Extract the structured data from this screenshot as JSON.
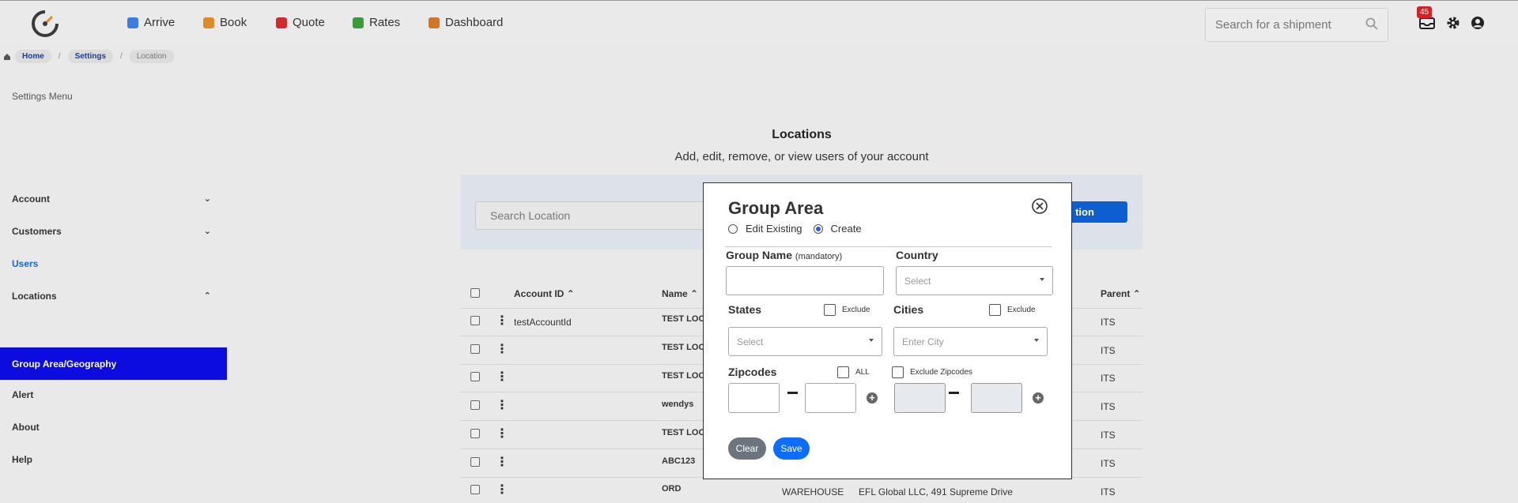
{
  "nav": {
    "items": [
      {
        "label": "Arrive",
        "icon": "arrive-icon",
        "color": "#3b7de0"
      },
      {
        "label": "Book",
        "icon": "book-icon",
        "color": "#e08a2a"
      },
      {
        "label": "Quote",
        "icon": "quote-icon",
        "color": "#d22b2b"
      },
      {
        "label": "Rates",
        "icon": "rates-icon",
        "color": "#3c9a3c"
      },
      {
        "label": "Dashboard",
        "icon": "dashboard-icon",
        "color": "#d0762a"
      }
    ],
    "search_placeholder": "Search for a shipment",
    "inbox_count": "45"
  },
  "breadcrumb": [
    "Home",
    "Settings",
    "Location"
  ],
  "sidebar": {
    "title": "Settings Menu",
    "items": [
      {
        "label": "Account",
        "chevron": "down"
      },
      {
        "label": "Customers",
        "chevron": "down"
      },
      {
        "label": "Users"
      },
      {
        "label": "Locations",
        "chevron": "up"
      },
      {
        "label": "Group Area/Geography"
      },
      {
        "label": "Alert"
      },
      {
        "label": "About"
      },
      {
        "label": "Help"
      }
    ]
  },
  "main": {
    "title": "Locations",
    "subtitle": "Add, edit, remove, or view users of your account",
    "search_placeholder": "Search Location",
    "add_button": "tion",
    "columns": [
      "Account ID",
      "Name",
      "Parent"
    ],
    "rows": [
      {
        "account": "testAccountId",
        "name": "TEST LOC",
        "type": "",
        "address": "",
        "parent": "ITS"
      },
      {
        "account": "",
        "name": "TEST LOC",
        "type": "",
        "address": "",
        "parent": "ITS"
      },
      {
        "account": "",
        "name": "TEST LOC",
        "type": "",
        "address": "",
        "parent": "ITS"
      },
      {
        "account": "",
        "name": "wendys",
        "type": "",
        "address": "",
        "parent": "ITS"
      },
      {
        "account": "",
        "name": "TEST LOC",
        "type": "",
        "address": "",
        "parent": "ITS"
      },
      {
        "account": "",
        "name": "ABC123",
        "type": "",
        "address": "",
        "parent": "ITS"
      },
      {
        "account": "",
        "name": "ORD",
        "type": "WAREHOUSE",
        "address": "EFL Global LLC, 491 Supreme Drive",
        "parent": "ITS"
      }
    ]
  },
  "modal": {
    "title": "Group Area",
    "mode_edit": "Edit Existing",
    "mode_create": "Create",
    "group_name_label": "Group Name",
    "group_name_hint": "(mandatory)",
    "country_label": "Country",
    "country_placeholder": "Select",
    "states_label": "States",
    "states_exclude": "Exclude",
    "states_placeholder": "Select",
    "cities_label": "Cities",
    "cities_exclude": "Exclude",
    "cities_placeholder": "Enter City",
    "zipcodes_label": "Zipcodes",
    "zip_all": "ALL",
    "zip_exclude": "Exclude Zipcodes",
    "clear_button": "Clear",
    "save_button": "Save"
  }
}
